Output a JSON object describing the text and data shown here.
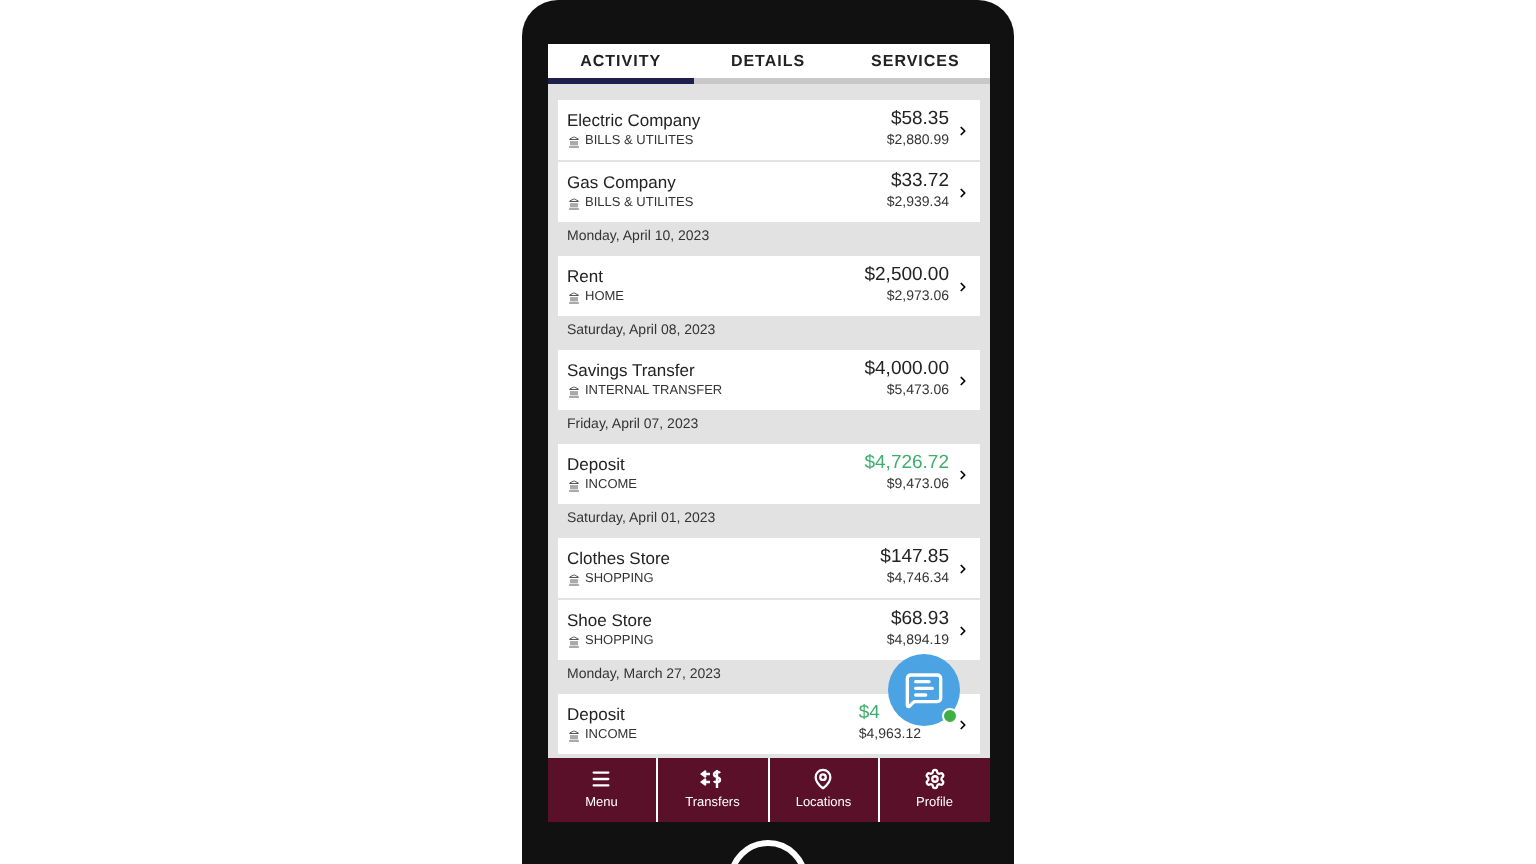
{
  "tabs": [
    {
      "label": "ACTIVITY",
      "selected": true
    },
    {
      "label": "DETAILS",
      "selected": false
    },
    {
      "label": "SERVICES",
      "selected": false
    }
  ],
  "entries": [
    {
      "kind": "transaction",
      "name": "Electric Company",
      "category": "BILLS & UTILITES",
      "amount": "$58.35",
      "balance": "$2,880.99",
      "credit": false
    },
    {
      "kind": "transaction",
      "name": "Gas Company",
      "category": "BILLS & UTILITES",
      "amount": "$33.72",
      "balance": "$2,939.34",
      "credit": false
    },
    {
      "kind": "date",
      "label": "Monday, April 10, 2023"
    },
    {
      "kind": "transaction",
      "name": "Rent",
      "category": "HOME",
      "amount": "$2,500.00",
      "balance": "$2,973.06",
      "credit": false
    },
    {
      "kind": "date",
      "label": "Saturday, April 08, 2023"
    },
    {
      "kind": "transaction",
      "name": "Savings Transfer",
      "category": "INTERNAL TRANSFER",
      "amount": "$4,000.00",
      "balance": "$5,473.06",
      "credit": false
    },
    {
      "kind": "date",
      "label": "Friday, April 07, 2023"
    },
    {
      "kind": "transaction",
      "name": "Deposit",
      "category": "INCOME",
      "amount": "$4,726.72",
      "balance": "$9,473.06",
      "credit": true
    },
    {
      "kind": "date",
      "label": "Saturday, April 01, 2023"
    },
    {
      "kind": "transaction",
      "name": "Clothes Store",
      "category": "SHOPPING",
      "amount": "$147.85",
      "balance": "$4,746.34",
      "credit": false
    },
    {
      "kind": "transaction",
      "name": "Shoe Store",
      "category": "SHOPPING",
      "amount": "$68.93",
      "balance": "$4,894.19",
      "credit": false
    },
    {
      "kind": "date",
      "label": "Monday, March 27, 2023"
    },
    {
      "kind": "transaction",
      "name": "Deposit",
      "category": "INCOME",
      "amount": "$4",
      "balance": "$4,963.12",
      "credit": true
    }
  ],
  "chat": {
    "online": true
  },
  "nav": [
    {
      "kind": "menu",
      "label": "Menu"
    },
    {
      "kind": "transfers",
      "label": "Transfers"
    },
    {
      "kind": "locations",
      "label": "Locations"
    },
    {
      "kind": "profile",
      "label": "Profile"
    }
  ]
}
